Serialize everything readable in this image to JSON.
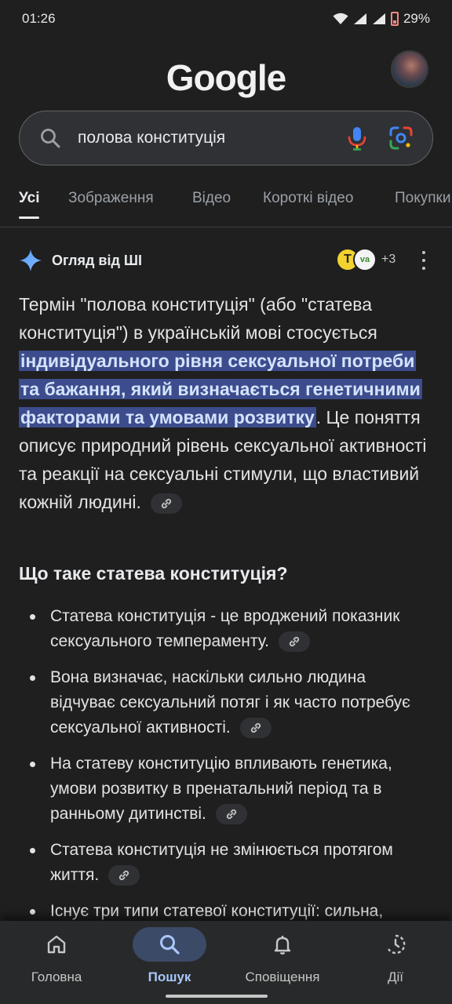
{
  "status": {
    "time": "01:26",
    "battery": "29%"
  },
  "header": {
    "logo": "Google"
  },
  "search": {
    "query": "полова конституція"
  },
  "tabs": [
    "Усі",
    "Зображення",
    "Відео",
    "Короткі відео",
    "Покупки"
  ],
  "ai_overview": {
    "title": "Огляд від ШІ",
    "sources_more": "+3",
    "source1_letter": "T",
    "source2_letter": "va",
    "summary_before": "Термін \"полова конституція\" (або \"статева конституція\") в українській мові стосується ",
    "summary_highlight": "індивідуального рівня сексуальної потреби та бажання, який визначається генетичними факторами та умовами розвитку",
    "summary_after": ". Це поняття описує природний рівень сексуальної активності та реакції на сексуальні стимули, що властивий кожній людині.",
    "section_heading": "Що таке статева конституція?",
    "bullets": [
      "Статева конституція - це вроджений показник сексуального темпераменту.",
      "Вона визначає, наскільки сильно людина відчуває сексуальний потяг і як часто потребує сексуальної активності.",
      "На статеву конституцію впливають генетика, умови розвитку в пренатальний період та в ранньому дитинстві.",
      "Статева конституція не змінюється протягом життя.",
      "Існує три типи статевої конституції: сильна,"
    ]
  },
  "bottom_nav": {
    "items": [
      {
        "label": "Головна",
        "icon": "home-icon"
      },
      {
        "label": "Пошук",
        "icon": "search-icon"
      },
      {
        "label": "Сповіщення",
        "icon": "bell-icon"
      },
      {
        "label": "Дії",
        "icon": "activity-icon"
      }
    ],
    "active": "Пошук"
  },
  "colors": {
    "background": "#1f1f1f",
    "highlight": "#3c4c8c",
    "accent": "#a8c7fa"
  }
}
